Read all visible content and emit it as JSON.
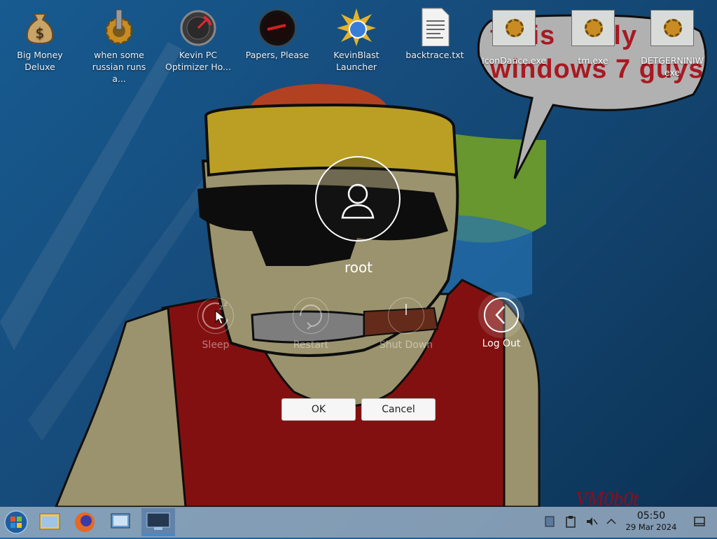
{
  "desktop_icons": [
    {
      "label1": "Big Money",
      "label2": "Deluxe",
      "icon": "money-bag-icon"
    },
    {
      "label1": "when some",
      "label2": "russian runs a...",
      "icon": "gear-icon"
    },
    {
      "label1": "Kevin PC",
      "label2": "Optimizer Ho...",
      "icon": "gauge-icon"
    },
    {
      "label1": "Papers, Please",
      "label2": "",
      "icon": "papers-please-icon"
    },
    {
      "label1": "KevinBlast",
      "label2": "Launcher",
      "icon": "starburst-icon"
    },
    {
      "label1": "backtrace.txt",
      "label2": "",
      "icon": "text-file-icon"
    }
  ],
  "top_right_icons": [
    {
      "label1": "IconDance.exe",
      "label2": "",
      "icon": "gear-box-icon"
    },
    {
      "label1": "tm.exe",
      "label2": "",
      "icon": "gear-box-icon"
    },
    {
      "label1": "DETGERNINIW",
      "label2": "exe",
      "icon": "gear-box-icon"
    }
  ],
  "wallpaper": {
    "speech_line1_a": "th",
    "speech_line1_b": "is",
    "speech_line1_c": "ally",
    "speech_line2": "windows 7 guys",
    "watermark": "VM0b0t"
  },
  "logout_dialog": {
    "username": "root",
    "actions": [
      {
        "label": "Sleep",
        "icon": "sleep-icon"
      },
      {
        "label": "Restart",
        "icon": "restart-icon"
      },
      {
        "label": "Shut Down",
        "icon": "power-icon"
      },
      {
        "label": "Log Out",
        "icon": "back-chevron-icon"
      }
    ],
    "ok_label": "OK",
    "cancel_label": "Cancel"
  },
  "taskbar": {
    "items": [
      "start-orb-icon",
      "file-manager-icon",
      "firefox-icon",
      "system-settings-icon",
      "vm-desktop-icon"
    ],
    "tray": [
      "updates-icon",
      "clipboard-icon",
      "volume-muted-icon",
      "chevron-up-icon"
    ],
    "time": "05:50",
    "date": "29 Mar 2024",
    "show_desktop": "show-desktop-icon"
  },
  "colors": {
    "speech_red": "#cf1f2a",
    "shirt_red": "#a01414",
    "hat_yellow": "#e5c22d",
    "skin": "#bdb486"
  }
}
